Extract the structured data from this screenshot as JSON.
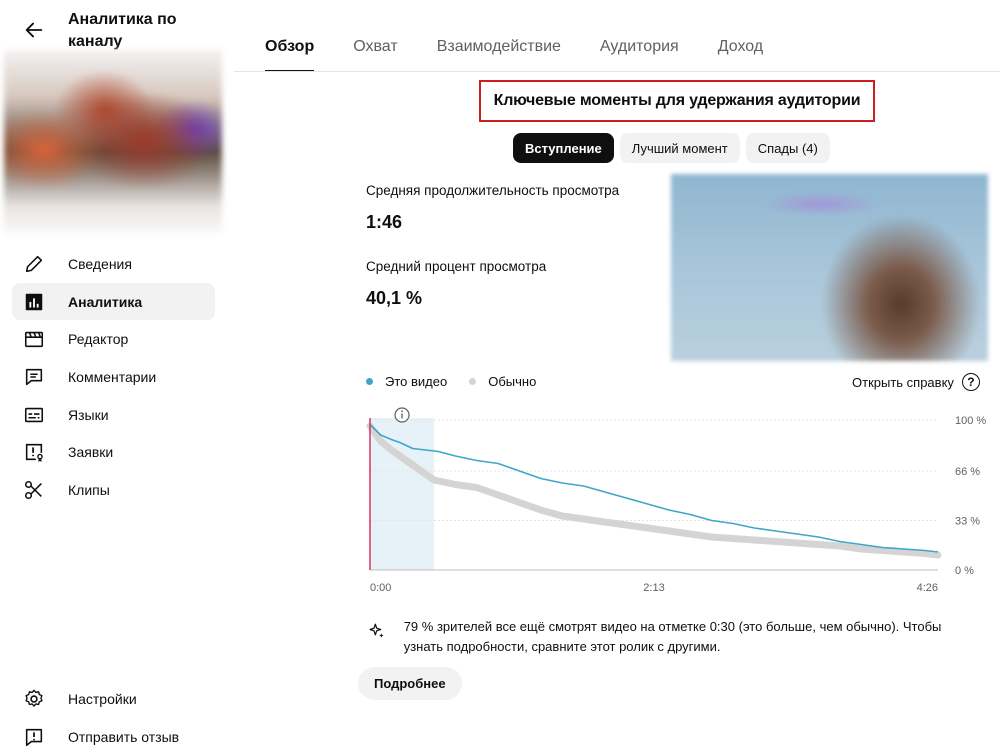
{
  "sidebar": {
    "title": "Аналитика по каналу",
    "items": [
      {
        "label": "Сведения",
        "icon": "pencil-icon"
      },
      {
        "label": "Аналитика",
        "icon": "analytics-icon",
        "active": true
      },
      {
        "label": "Редактор",
        "icon": "editor-icon"
      },
      {
        "label": "Комментарии",
        "icon": "comment-icon"
      },
      {
        "label": "Языки",
        "icon": "subtitles-icon"
      },
      {
        "label": "Заявки",
        "icon": "claims-icon"
      },
      {
        "label": "Клипы",
        "icon": "scissors-icon"
      }
    ],
    "bottom_items": [
      {
        "label": "Настройки",
        "icon": "gear-icon"
      },
      {
        "label": "Отправить отзыв",
        "icon": "feedback-icon"
      }
    ]
  },
  "tabs": [
    {
      "label": "Обзор",
      "active": true
    },
    {
      "label": "Охват"
    },
    {
      "label": "Взаимодействие"
    },
    {
      "label": "Аудитория"
    },
    {
      "label": "Доход"
    }
  ],
  "main": {
    "section_title": "Ключевые моменты для удержания аудитории",
    "chips": [
      {
        "label": "Вступление",
        "active": true
      },
      {
        "label": "Лучший момент"
      },
      {
        "label": "Спады (4)"
      }
    ],
    "metrics": {
      "avg_duration_label": "Средняя продолжительность просмотра",
      "avg_duration_value": "1:46",
      "avg_percent_label": "Средний процент просмотра",
      "avg_percent_value": "40,1 %"
    },
    "legend": {
      "this_video": "Это видео",
      "typical": "Обычно"
    },
    "help_link": "Открыть справку",
    "insight": "79 % зрителей все ещё смотрят видео на отметке 0:30 (это больше, чем обычно). Чтобы узнать подробности, сравните этот ролик с другими.",
    "more_button": "Подробнее"
  },
  "colors": {
    "this_video": "#3ea6c8",
    "typical": "#d4d4d4",
    "highlight": "#e6f2f8",
    "playhead": "#d6335b",
    "title_border": "#cc1f1f"
  },
  "chart_data": {
    "type": "line",
    "xlabel": "",
    "ylabel": "",
    "x_ticks": [
      "0:00",
      "2:13",
      "4:26"
    ],
    "y_ticks": [
      "100 %",
      "66 %",
      "33 %",
      "0 %"
    ],
    "xlim": [
      0,
      266
    ],
    "ylim": [
      0,
      100
    ],
    "highlight_range": [
      0,
      30
    ],
    "series": [
      {
        "name": "Это видео",
        "x": [
          0,
          5,
          10,
          14,
          20,
          26,
          32,
          40,
          50,
          60,
          70,
          80,
          90,
          100,
          110,
          120,
          130,
          140,
          150,
          160,
          170,
          180,
          190,
          200,
          210,
          220,
          230,
          240,
          250,
          260,
          266
        ],
        "values": [
          97,
          90,
          87,
          85,
          81,
          80,
          79,
          76,
          73,
          71,
          66,
          61,
          58,
          56,
          52,
          48,
          44,
          40,
          37,
          33,
          31,
          28,
          26,
          24,
          22,
          19,
          17,
          15,
          14,
          13,
          12
        ]
      },
      {
        "name": "Обычно",
        "x": [
          0,
          5,
          10,
          20,
          30,
          40,
          50,
          60,
          70,
          80,
          90,
          100,
          110,
          120,
          130,
          140,
          150,
          160,
          170,
          180,
          190,
          200,
          210,
          220,
          230,
          240,
          250,
          260,
          266
        ],
        "values": [
          96,
          86,
          80,
          70,
          60,
          57,
          55,
          50,
          45,
          40,
          36,
          34,
          32,
          30,
          28,
          26,
          24,
          22,
          21,
          20,
          19,
          18,
          17,
          16,
          14,
          13,
          12,
          11,
          10
        ]
      }
    ]
  }
}
